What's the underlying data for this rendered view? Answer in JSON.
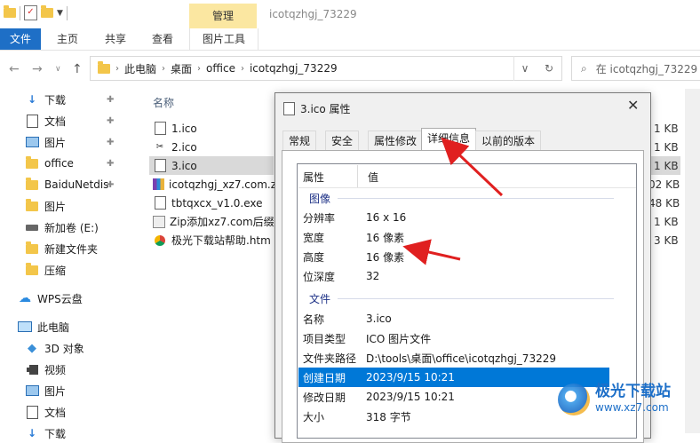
{
  "window": {
    "title": "icotqzhgj_73229",
    "manage_tab": "管理"
  },
  "ribbon": {
    "tabs": [
      "文件",
      "主页",
      "共享",
      "查看",
      "图片工具"
    ]
  },
  "address": {
    "crumbs": [
      "此电脑",
      "桌面",
      "office",
      "icotqzhgj_73229"
    ],
    "search_placeholder": "在 icotqzhgj_73229"
  },
  "nav_pane": {
    "items": [
      {
        "label": "下载",
        "icon": "download-icon",
        "pinned": true
      },
      {
        "label": "文档",
        "icon": "document-icon",
        "pinned": true
      },
      {
        "label": "图片",
        "icon": "picture-icon",
        "pinned": true
      },
      {
        "label": "office",
        "icon": "folder-icon",
        "pinned": true
      },
      {
        "label": "BaiduNetdis",
        "icon": "folder-icon",
        "pinned": true
      },
      {
        "label": "图片",
        "icon": "folder-icon",
        "pinned": false
      },
      {
        "label": "新加卷 (E:)",
        "icon": "drive-icon",
        "pinned": false
      },
      {
        "label": "新建文件夹",
        "icon": "folder-icon",
        "pinned": false
      },
      {
        "label": "压缩",
        "icon": "folder-icon",
        "pinned": false
      },
      {
        "label": "WPS云盘",
        "icon": "cloud-icon",
        "pinned": false
      },
      {
        "label": "此电脑",
        "icon": "computer-icon",
        "pinned": false
      },
      {
        "label": "3D 对象",
        "icon": "3d-objects-icon",
        "pinned": false
      },
      {
        "label": "视频",
        "icon": "video-icon",
        "pinned": false
      },
      {
        "label": "图片",
        "icon": "picture-icon",
        "pinned": false
      },
      {
        "label": "文档",
        "icon": "document-icon",
        "pinned": false
      },
      {
        "label": "下载",
        "icon": "download-icon",
        "pinned": false
      }
    ]
  },
  "file_list": {
    "column_name": "名称",
    "files": [
      {
        "name": "1.ico",
        "size": "1 KB"
      },
      {
        "name": "2.ico",
        "size": "1 KB"
      },
      {
        "name": "3.ico",
        "size": "1 KB",
        "selected": true
      },
      {
        "name": "icotqzhgj_xz7.com.zi",
        "size": "02 KB"
      },
      {
        "name": "tbtqxcx_v1.0.exe",
        "size": "48 KB"
      },
      {
        "name": "Zip添加xz7.com后缀(",
        "size": "1 KB"
      },
      {
        "name": "极光下载站帮助.htm",
        "size": "3 KB"
      }
    ]
  },
  "dialog": {
    "title": "3.ico 属性",
    "tabs": [
      "常规",
      "安全",
      "属性修改",
      "详细信息",
      "以前的版本"
    ],
    "active_tab": "详细信息",
    "header": {
      "prop": "属性",
      "value": "值"
    },
    "groups": [
      {
        "name": "图像",
        "rows": [
          {
            "k": "分辨率",
            "v": "16 x 16"
          },
          {
            "k": "宽度",
            "v": "16 像素"
          },
          {
            "k": "高度",
            "v": "16 像素"
          },
          {
            "k": "位深度",
            "v": "32"
          }
        ]
      },
      {
        "name": "文件",
        "rows": [
          {
            "k": "名称",
            "v": "3.ico"
          },
          {
            "k": "项目类型",
            "v": "ICO 图片文件"
          },
          {
            "k": "文件夹路径",
            "v": "D:\\tools\\桌面\\office\\icotqzhgj_73229"
          },
          {
            "k": "创建日期",
            "v": "2023/9/15 10:21",
            "selected": true
          },
          {
            "k": "修改日期",
            "v": "2023/9/15 10:21"
          },
          {
            "k": "大小",
            "v": "318 字节"
          }
        ]
      }
    ]
  },
  "watermark": {
    "name": "极光下载站",
    "url": "www.xz7.com"
  },
  "colors": {
    "accent": "#0078d7",
    "file_tab": "#1e6fc6",
    "manage": "#fbe7a1",
    "arrow": "#e02020"
  }
}
